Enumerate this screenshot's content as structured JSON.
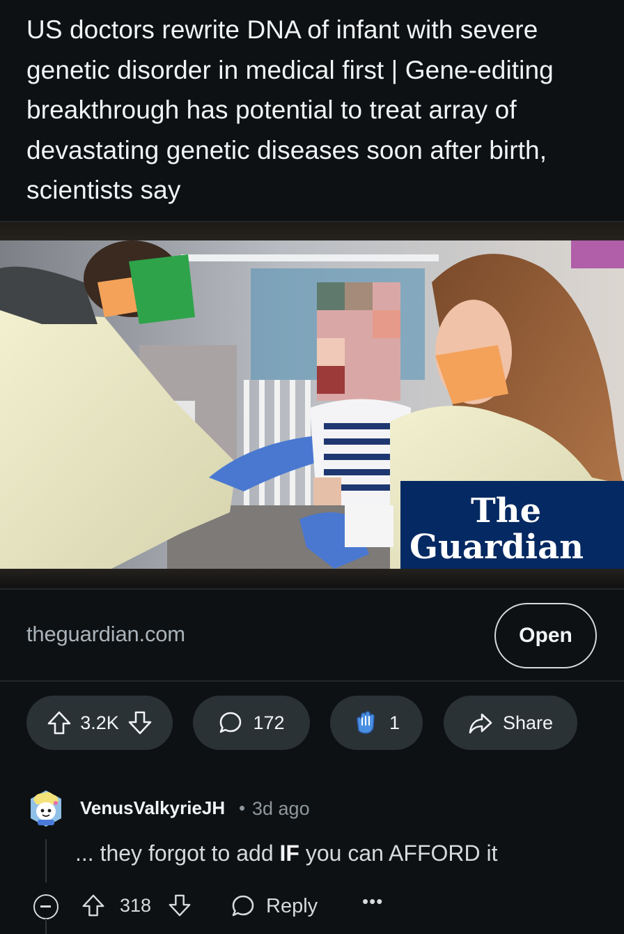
{
  "post": {
    "title": "US doctors rewrite DNA of infant with severe genetic disorder in medical first | Gene-editing breakthrough has potential to treat array of devastating genetic diseases soon after birth, scientists say",
    "image": {
      "watermark_line1": "The",
      "watermark_line2": "Guardian"
    }
  },
  "link": {
    "domain": "theguardian.com",
    "open_label": "Open"
  },
  "actions": {
    "score": "3.2K",
    "comments": "172",
    "awards": "1",
    "share_label": "Share",
    "upvote_icon": "arrow-up-outline-icon",
    "downvote_icon": "arrow-down-outline-icon",
    "comment_icon": "speech-bubble-icon",
    "award_icon": "clapping-hands-icon",
    "share_icon": "share-arrow-icon"
  },
  "comment": {
    "author": "VenusValkyrieJH",
    "separator": "•",
    "time": "3d ago",
    "body_pre": "... they forgot to add ",
    "body_bold": "IF",
    "body_post": " you can AFFORD it",
    "score": "318",
    "reply_label": "Reply",
    "more_label": "•••"
  },
  "colors": {
    "background": "#0e1113",
    "pill": "#2a3236",
    "guardian_blue": "#052962"
  }
}
